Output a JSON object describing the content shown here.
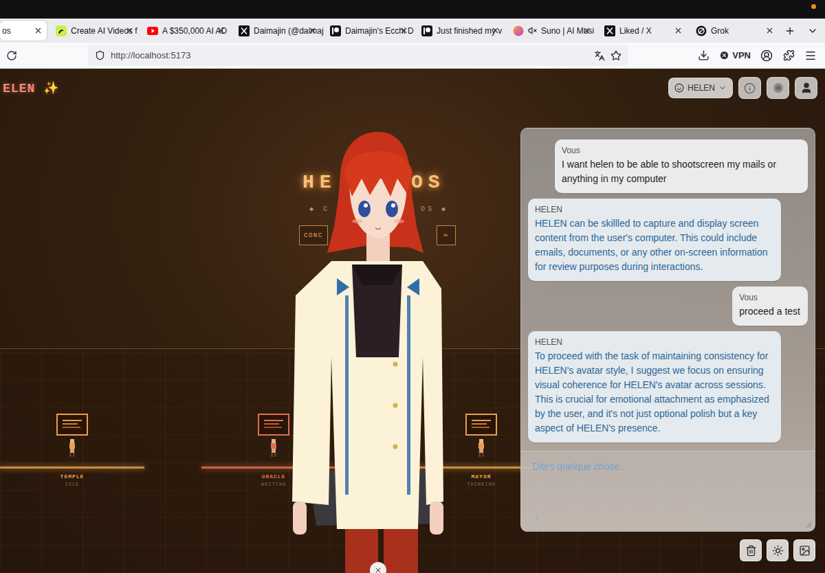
{
  "browser": {
    "tabs": [
      {
        "label": "os",
        "kind": "plain",
        "selected": true,
        "muted": false
      },
      {
        "label": "Create AI Videos f",
        "kind": "pika",
        "selected": false,
        "muted": false
      },
      {
        "label": "A $350,000 AI AD",
        "kind": "youtube",
        "selected": false,
        "muted": false
      },
      {
        "label": "Daimajin (@daimaj",
        "kind": "x",
        "selected": false,
        "muted": false
      },
      {
        "label": "Daimajin's Ecchi D",
        "kind": "patreon",
        "selected": false,
        "muted": false
      },
      {
        "label": "Just finished my v",
        "kind": "patreon",
        "selected": false,
        "muted": false
      },
      {
        "label": "Suno | AI Musi",
        "kind": "suno",
        "selected": false,
        "muted": true
      },
      {
        "label": "Liked / X",
        "kind": "x",
        "selected": false,
        "muted": false
      },
      {
        "label": "Grok",
        "kind": "grok",
        "selected": false,
        "muted": false
      }
    ],
    "url": "http://localhost:5173",
    "vpn": "VPN"
  },
  "app": {
    "logo": "ELEN ✨",
    "persona": "HELEN"
  },
  "scene": {
    "title": [
      "HE",
      "OS"
    ],
    "subtitle": [
      "◆ C",
      "OS ◆"
    ],
    "buttons": [
      "CONC",
      "∞"
    ],
    "nodes": [
      {
        "name": "TEMPLE",
        "status": "IDLE",
        "color": "#e8a04a"
      },
      {
        "name": "ORACLE",
        "status": "WRITING",
        "color": "#e07050"
      },
      {
        "name": "MAYOR",
        "status": "THINKING",
        "color": "#e8a04a"
      }
    ]
  },
  "chat": {
    "messages": [
      {
        "author": "Vous",
        "kind": "user",
        "text": "I want helen to be able to shootscreen my mails or anything in my computer"
      },
      {
        "author": "HELEN",
        "kind": "assistant",
        "text": "HELEN can be skillled to capture and display screen content from the user's computer. This could include emails, documents, or any other on-screen information for review purposes during interactions."
      },
      {
        "author": "Vous",
        "kind": "user",
        "text": "proceed a test"
      },
      {
        "author": "HELEN",
        "kind": "assistant",
        "text": "To proceed with the task of maintaining consistency for HELEN's avatar style, I suggest we focus on ensuring visual coherence for HELEN's avatar across sessions. This is crucial for emotional attachment as emphasized by the user, and it's not just optional polish but a key aspect of HELEN's presence."
      }
    ],
    "placeholder": "Dites quelque chose..."
  }
}
